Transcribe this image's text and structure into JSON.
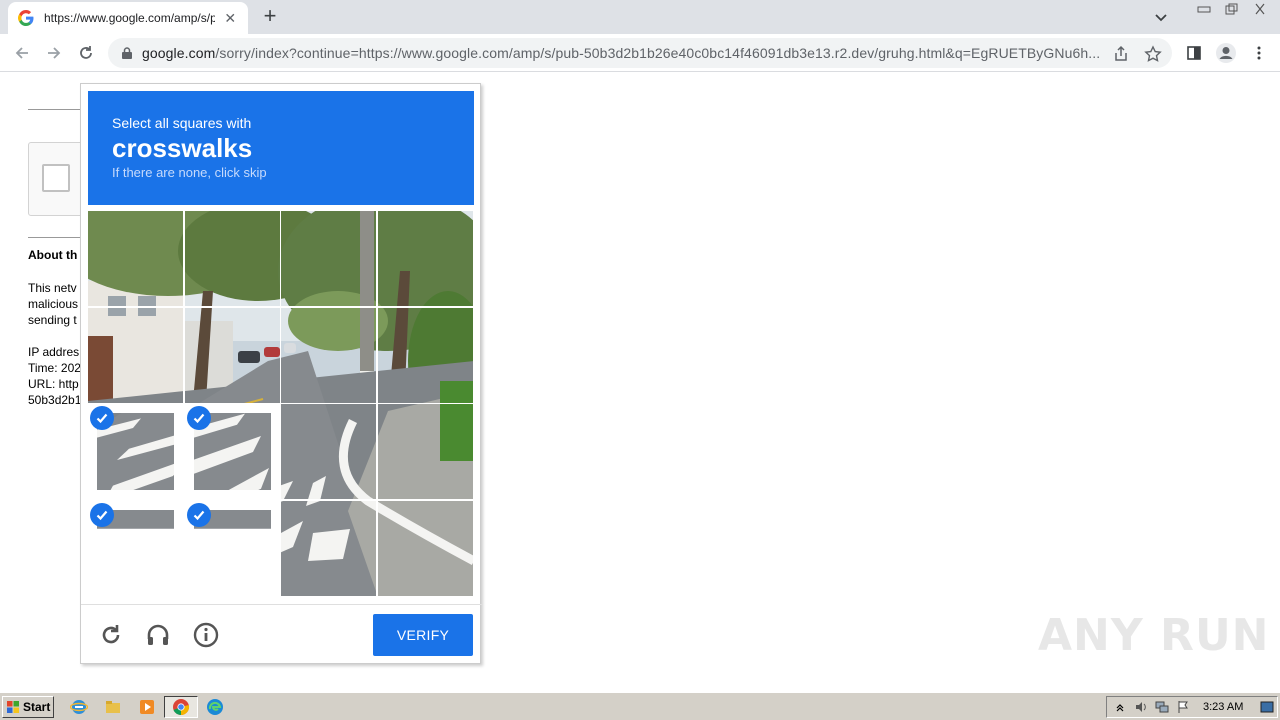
{
  "browser": {
    "tab_title": "https://www.google.com/amp/s/pub",
    "tab_close": "✕",
    "new_tab": "+",
    "url_host": "google.com",
    "url_rest": "/sorry/index?continue=https://www.google.com/amp/s/pub-50b3d2b1b26e40c0bc14f46091db3e13.r2.dev/gruhg.html&q=EgRUETByGNu6h..."
  },
  "background_page": {
    "heading": "About th",
    "para1": "This netv\nmalicious\nsending t",
    "para2": "IP addres\nTime: 202\nURL: http\n50b3d2b1"
  },
  "captcha": {
    "instruction": "Select all squares with",
    "keyword": "crosswalks",
    "hint": "If there are none, click skip",
    "verify_label": "VERIFY",
    "selected_tiles": [
      8,
      9,
      12,
      13
    ],
    "accent_color": "#1a73e8"
  },
  "watermark": "ANY RUN",
  "taskbar": {
    "start_label": "Start",
    "clock": "3:23 AM"
  }
}
